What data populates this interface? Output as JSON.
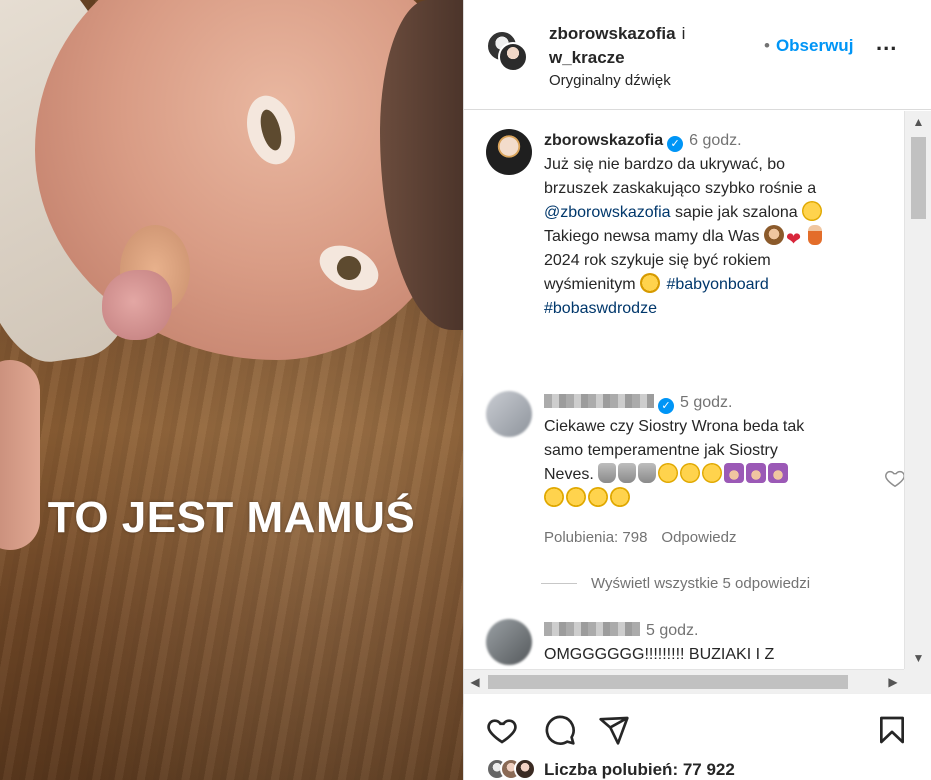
{
  "media": {
    "overlay_text": "TO JEST MAMUŚ"
  },
  "post_header": {
    "username_1": "zborowskazofia",
    "conjunction": "i",
    "username_2": "w_kracze",
    "audio": "Oryginalny dźwięk",
    "follow_label": "Obserwuj",
    "follow_dot": "•",
    "more_glyph": "..."
  },
  "caption": {
    "username": "zborowskazofia",
    "verified_glyph": "✓",
    "time": "6 godz.",
    "line_1": "Już się nie bardzo da ukrywać, bo",
    "line_2": "brzuszek zaskakująco szybko rośnie a",
    "mention": "@zborowskazofia",
    "line_3_rest": " sapie jak szalona",
    "line_4": "Takiego newsa mamy dla Was",
    "line_5": "2024 rok szykuje się być rokiem",
    "line_6": "wyśmienitym",
    "hashtag_1": "#babyonboard",
    "hashtag_2": "#bobaswdrodze"
  },
  "comments": [
    {
      "time": "5 godz.",
      "line_1": "Ciekawe czy Siostry Wrona beda tak",
      "line_2": "samo temperamentne jak Siostry",
      "line_3": "Neves.",
      "likes_label": "Polubienia: 798",
      "reply_label": "Odpowiedz"
    },
    {
      "time": "5 godz.",
      "line_1": "OMGGGGGG!!!!!!!!! BUZIAKI I Z"
    }
  ],
  "view_replies": "Wyświetl wszystkie 5 odpowiedzi",
  "scroll": {
    "up": "▲",
    "down": "▼",
    "left": "◀",
    "right": "▶"
  },
  "likes": {
    "label": "Liczba polubień: 77 922"
  },
  "colors": {
    "accent_blue": "#0095f6",
    "text": "#262626",
    "muted": "#737373",
    "tag": "#00376b"
  }
}
